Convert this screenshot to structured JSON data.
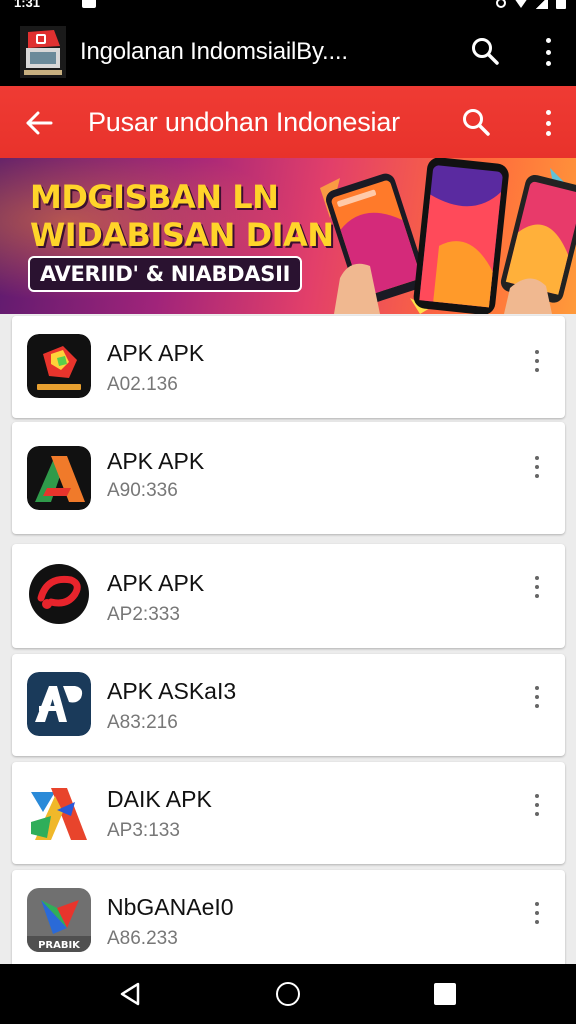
{
  "status_bar": {
    "time": "1:31"
  },
  "app_bar": {
    "title": "Ingolanan IndomsiailBy...."
  },
  "toolbar": {
    "title": "Pusar undohan Indonesiar"
  },
  "banner": {
    "line1": "MDGISBAN LN",
    "line2": "WIDABISAN DIAN",
    "subtitle": "AVERIID' & NIABDASII"
  },
  "apps": [
    {
      "name": "APK APK",
      "version": "A02.136",
      "icon": "red-gem-icon"
    },
    {
      "name": "APK APK",
      "version": "A90:336",
      "icon": "green-a-icon"
    },
    {
      "name": "APK APK",
      "version": "AP2:333",
      "icon": "red-swirl-icon"
    },
    {
      "name": "APK ASKaI3",
      "version": "A83:216",
      "icon": "ab-blue-icon"
    },
    {
      "name": "DAIK APK",
      "version": "AP3:133",
      "icon": "colorful-a-icon"
    },
    {
      "name": "NbGANAeI0",
      "version": "A86.233",
      "icon": "prabik-icon",
      "icon_label": "PRABIK"
    }
  ],
  "colors": {
    "toolbar": "#e8322b",
    "banner_text": "#ffd42a"
  }
}
